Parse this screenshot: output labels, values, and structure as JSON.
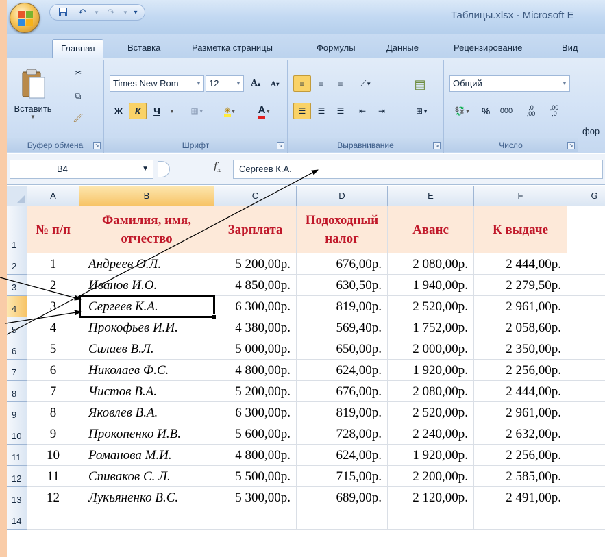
{
  "window": {
    "title": "Таблицы.xlsx - Microsoft E"
  },
  "quick_access": {
    "save_icon": "save-icon",
    "undo_icon": "undo-icon",
    "redo_icon": "redo-icon"
  },
  "tabs": [
    "Главная",
    "Вставка",
    "Разметка страницы",
    "Формулы",
    "Данные",
    "Рецензирование",
    "Вид"
  ],
  "ribbon": {
    "clipboard": {
      "paste_label": "Вставить",
      "group_label": "Буфер обмена"
    },
    "font": {
      "font_name": "Times New Rom",
      "font_size": "12",
      "bold": "Ж",
      "italic": "К",
      "underline": "Ч",
      "group_label": "Шрифт"
    },
    "alignment": {
      "group_label": "Выравнивание"
    },
    "number": {
      "format": "Общий",
      "percent": "%",
      "thousands": "000",
      "group_label": "Число"
    },
    "styles": {
      "partial_label": "фор"
    }
  },
  "formula_bar": {
    "cell_ref": "B4",
    "fx": "fx",
    "value": "Сергеев К.А."
  },
  "grid": {
    "columns": [
      "A",
      "B",
      "C",
      "D",
      "E",
      "F",
      "G"
    ],
    "selected_column": "B",
    "selected_row": "4",
    "row_numbers": [
      "1",
      "2",
      "3",
      "4",
      "5",
      "6",
      "7",
      "8",
      "9",
      "10",
      "11",
      "12",
      "13",
      "14"
    ],
    "header": {
      "num": "№ п/п",
      "name": "Фамилия, имя, отчество",
      "salary": "Зарплата",
      "tax": "Подоходный налог",
      "advance": "Аванс",
      "payout": "К выдаче"
    },
    "rows": [
      [
        "1",
        "Андреев О.Л.",
        "5 200,00р.",
        "676,00р.",
        "2 080,00р.",
        "2 444,00р."
      ],
      [
        "2",
        "Иванов И.О.",
        "4 850,00р.",
        "630,50р.",
        "1 940,00р.",
        "2 279,50р."
      ],
      [
        "3",
        "Сергеев К.А.",
        "6 300,00р.",
        "819,00р.",
        "2 520,00р.",
        "2 961,00р."
      ],
      [
        "4",
        "Прокофьев И.И.",
        "4 380,00р.",
        "569,40р.",
        "1 752,00р.",
        "2 058,60р."
      ],
      [
        "5",
        "Силаев В.Л.",
        "5 000,00р.",
        "650,00р.",
        "2 000,00р.",
        "2 350,00р."
      ],
      [
        "6",
        "Николаев Ф.С.",
        "4 800,00р.",
        "624,00р.",
        "1 920,00р.",
        "2 256,00р."
      ],
      [
        "7",
        "Чистов В.А.",
        "5 200,00р.",
        "676,00р.",
        "2 080,00р.",
        "2 444,00р."
      ],
      [
        "8",
        "Яковлев В.А.",
        "6 300,00р.",
        "819,00р.",
        "2 520,00р.",
        "2 961,00р."
      ],
      [
        "9",
        "Прокопенко И.В.",
        "5 600,00р.",
        "728,00р.",
        "2 240,00р.",
        "2 632,00р."
      ],
      [
        "10",
        "Романова М.И.",
        "4 800,00р.",
        "624,00р.",
        "1 920,00р.",
        "2 256,00р."
      ],
      [
        "11",
        "Спиваков С. Л.",
        "5 500,00р.",
        "715,00р.",
        "2 200,00р.",
        "2 585,00р."
      ],
      [
        "12",
        "Лукьяненко В.С.",
        "5 300,00р.",
        "689,00р.",
        "2 120,00р.",
        "2 491,00р."
      ]
    ]
  },
  "colors": {
    "header_fill": "#fde9d9",
    "header_text": "#c0182a",
    "selection": "#f7c467",
    "slide_bg": "#f9cca8"
  }
}
